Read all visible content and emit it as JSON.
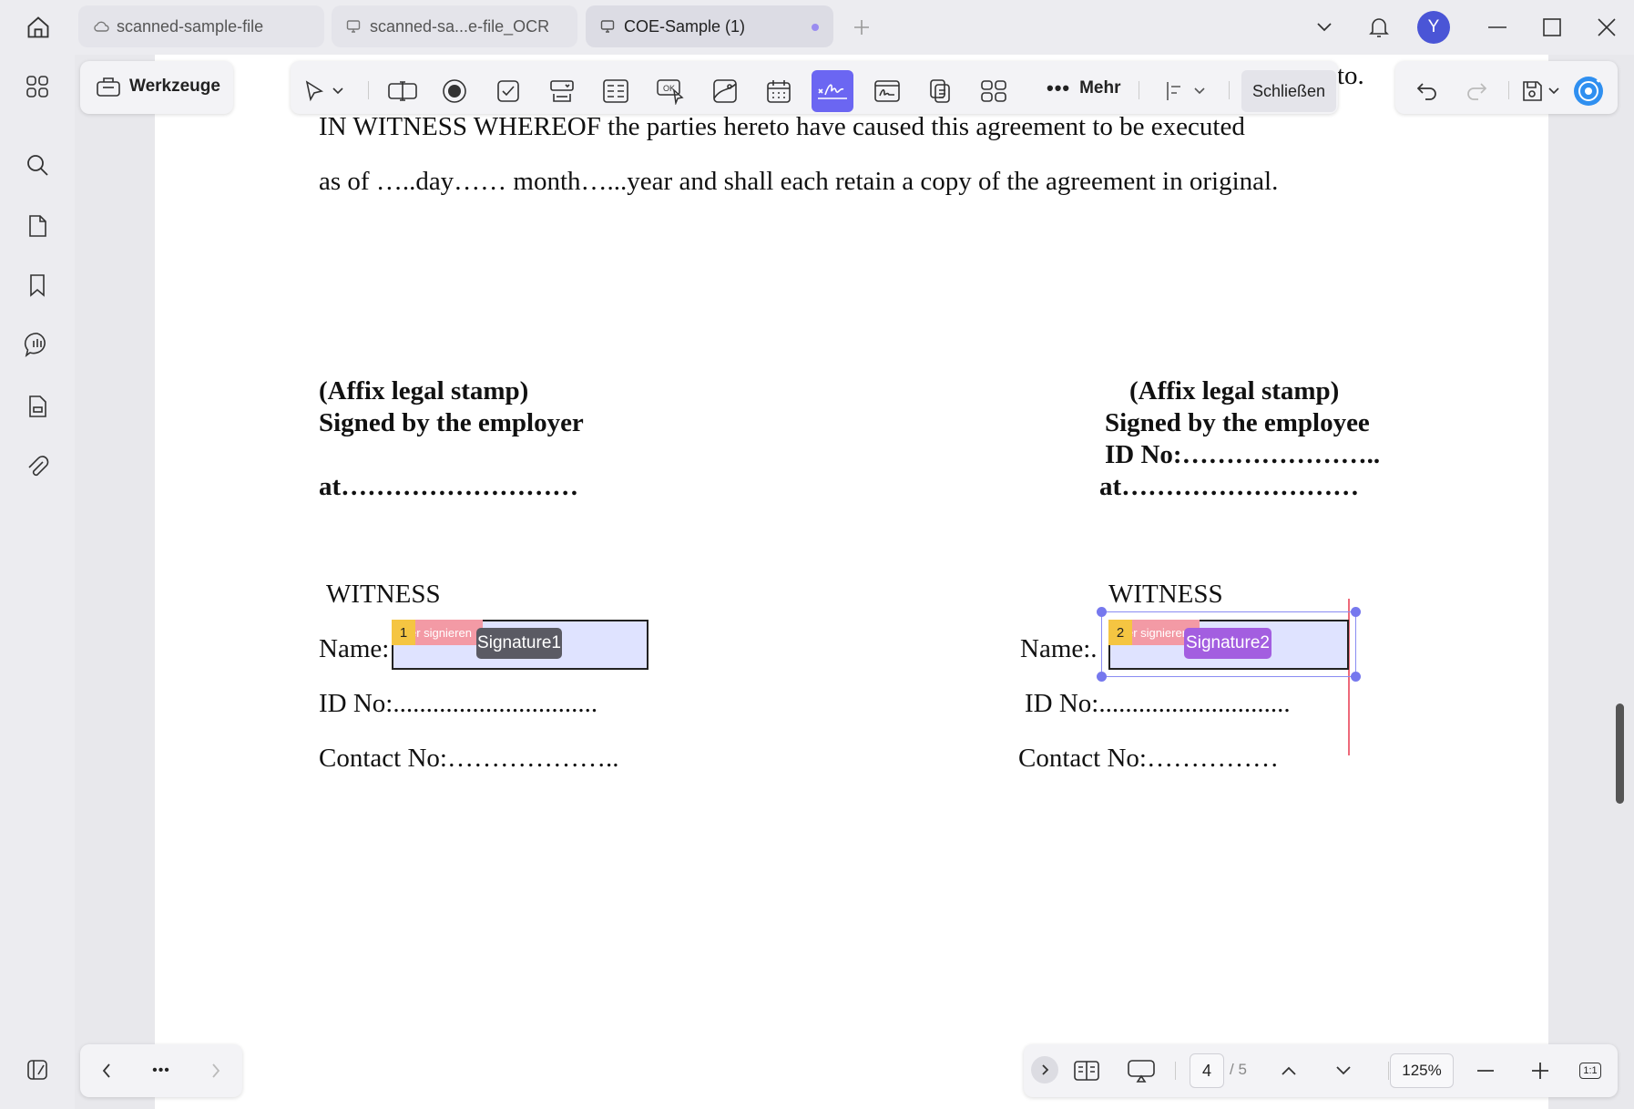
{
  "tabs": [
    {
      "label": "scanned-sample-file",
      "icon": "cloud-icon"
    },
    {
      "label": "scanned-sa...e-file_OCR",
      "icon": "monitor-icon"
    },
    {
      "label": "COE-Sample (1)",
      "icon": "monitor-icon",
      "unsaved": true
    }
  ],
  "user": {
    "avatar_letter": "Y"
  },
  "toolbar": {
    "tools_label": "Werkzeuge",
    "more_label": "Mehr",
    "close_label": "Schließen"
  },
  "document": {
    "lines": [
      "to.",
      "IN WITNESS WHEREOF the parties hereto have caused this agreement to be executed",
      "as of …..day…… month…...year and shall each retain a copy of the agreement in original."
    ],
    "employer": {
      "stamp": "(Affix legal stamp)",
      "signed_by": "Signed by the employer",
      "at": "at………………………"
    },
    "employee": {
      "stamp": "(Affix legal stamp)",
      "signed_by": "Signed by the employee",
      "id_no": "ID No:…………………..",
      "at": "at………………………"
    },
    "witness_left": {
      "heading": "WITNESS",
      "name": "Name:",
      "id_no": "ID No:...............................",
      "contact": "Contact No:………………..",
      "field_number": "1",
      "field_role": "er signieren",
      "field_name": "Signature1"
    },
    "witness_right": {
      "heading": "WITNESS",
      "name": "Name:.",
      "id_no": "ID No:.............................",
      "contact": "Contact No:……………",
      "field_number": "2",
      "field_role": "er signieren",
      "field_name": "Signature2"
    }
  },
  "bottom_bar": {
    "current_page": "4",
    "total_pages": "/ 5",
    "zoom": "125%",
    "actual_size": "1:1"
  },
  "colors": {
    "accent": "#6b66f2",
    "field_fill": "#dfe3ff",
    "signature1_label": "#5a5a63",
    "signature2_label": "#a35ee0",
    "number_tag": "#f5c542",
    "role_tag": "#f39aa5",
    "guide_line": "#ee6a7a"
  }
}
